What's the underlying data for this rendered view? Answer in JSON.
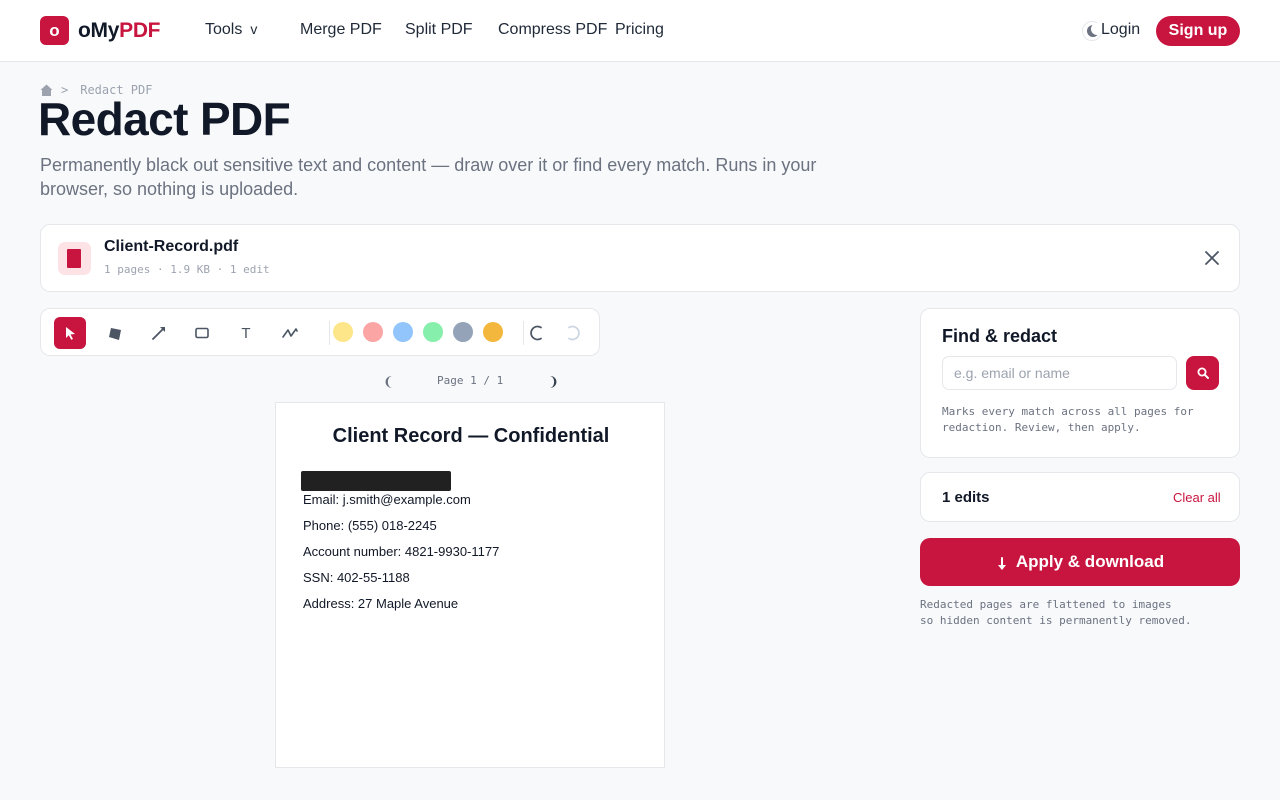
{
  "header": {
    "logo_badge": "o",
    "logo_text": "oMy",
    "logo_accent": "PDF",
    "nav": {
      "tools": "Tools",
      "tools_chevron": "v",
      "merge": "Merge PDF",
      "split": "Split PDF",
      "compress": "Compress PDF",
      "pricing": "Pricing"
    },
    "login": "Login",
    "signup": "Sign up"
  },
  "breadcrumb": {
    "separator": ">",
    "current": "Redact PDF"
  },
  "page": {
    "title": "Redact PDF",
    "subtitle": "Permanently black out sensitive text and content — draw over it or find every match. Runs in your browser, so nothing is uploaded."
  },
  "file": {
    "name": "Client-Record.pdf",
    "meta": "1 pages · 1.9 KB · 1 edit"
  },
  "toolbar": {
    "text_tool_label": "T",
    "swatches": [
      "#fde68a",
      "#fca5a5",
      "#93c5fd",
      "#86efac",
      "#94a3b8",
      "#f4b73e"
    ]
  },
  "pager": {
    "prev": "❨",
    "label": "Page 1 / 1",
    "next": "❩"
  },
  "document": {
    "title": "Client Record — Confidential",
    "lines": [
      "Email: j.smith@example.com",
      "Phone: (555) 018-2245",
      "Account number: 4821-9930-1177",
      "SSN: 402-55-1188",
      "Address: 27 Maple Avenue"
    ]
  },
  "find": {
    "title": "Find & redact",
    "placeholder": "e.g. email or name",
    "hint": "Marks every match across all pages for redaction. Review, then apply."
  },
  "edits": {
    "count_label": "1 edits",
    "clear_label": "Clear all"
  },
  "apply": {
    "label": "Apply & download",
    "note": "Redacted pages are flattened to images\nso hidden content is permanently removed."
  },
  "colors": {
    "accent": "#c8153f",
    "redaction": "#212121"
  }
}
